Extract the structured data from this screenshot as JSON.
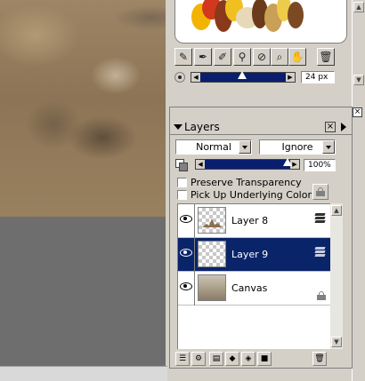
{
  "brush_palette": {
    "tools": [
      {
        "name": "brush-category-icon"
      },
      {
        "name": "brush-pen-icon"
      },
      {
        "name": "brush-variant-icon"
      },
      {
        "name": "dropper-icon"
      },
      {
        "name": "dropper-settings-icon"
      },
      {
        "name": "magnifier-icon"
      },
      {
        "name": "grabber-hand-icon"
      },
      {
        "name": "trash-icon"
      }
    ],
    "size": {
      "value_text": "24 px",
      "level_fraction": 0.48
    }
  },
  "layers": {
    "title": "Layers",
    "composite_method": "Normal",
    "composite_depth": "Ignore",
    "opacity": {
      "value_text": "100%",
      "level_fraction": 1.0
    },
    "preserve_transparency": {
      "label": "Preserve Transparency",
      "checked": false
    },
    "pick_up_underlying_color": {
      "label": "Pick Up Underlying Color",
      "checked": false
    },
    "items": [
      {
        "name": "Layer 8",
        "selected": false,
        "visible": true
      },
      {
        "name": "Layer 9",
        "selected": true,
        "visible": true
      },
      {
        "name": "Canvas",
        "selected": false,
        "visible": true,
        "locked": true
      }
    ]
  },
  "colors": {
    "selection": "#0a246a",
    "slider_fill": "#0a1e6e",
    "panel_bg": "#d4d0c8",
    "canvas_bg": "#6e6e6e"
  }
}
